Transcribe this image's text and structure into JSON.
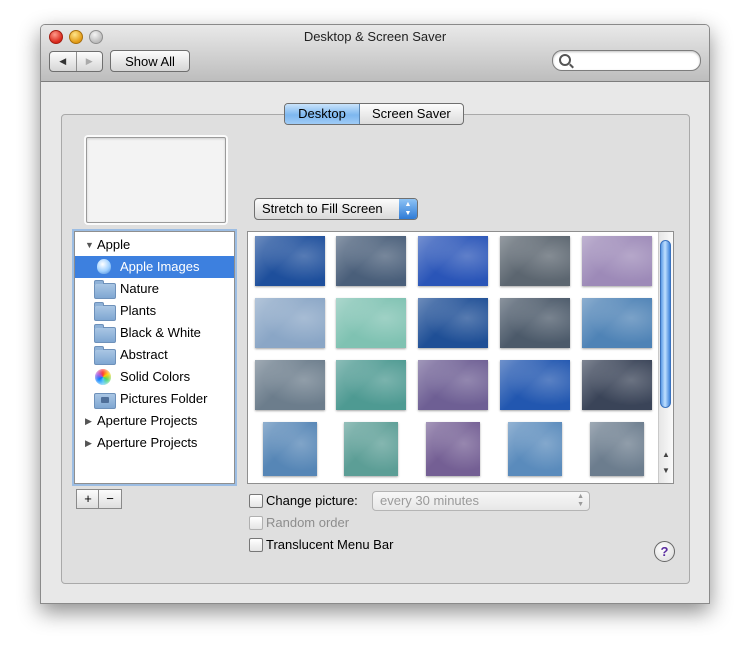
{
  "window": {
    "title": "Desktop & Screen Saver"
  },
  "toolbar": {
    "back_glyph": "◀",
    "forward_glyph": "▶",
    "show_all_label": "Show All",
    "search_placeholder": ""
  },
  "tabs": [
    {
      "label": "Desktop",
      "active": true
    },
    {
      "label": "Screen Saver",
      "active": false
    }
  ],
  "fill_popup": {
    "value": "Stretch to Fill Screen",
    "arrows": "▲▼"
  },
  "sidebar": {
    "items": [
      {
        "label": "Apple",
        "kind": "group",
        "expanded": true,
        "icon": "disclosure-triangle-open"
      },
      {
        "label": "Apple Images",
        "kind": "item",
        "selected": true,
        "icon": "apple-icon"
      },
      {
        "label": "Nature",
        "kind": "item",
        "icon": "folder-icon"
      },
      {
        "label": "Plants",
        "kind": "item",
        "icon": "folder-icon"
      },
      {
        "label": "Black & White",
        "kind": "item",
        "icon": "folder-icon"
      },
      {
        "label": "Abstract",
        "kind": "item",
        "icon": "folder-icon"
      },
      {
        "label": "Solid Colors",
        "kind": "item",
        "icon": "color-wheel-icon"
      },
      {
        "label": "Pictures Folder",
        "kind": "item",
        "icon": "pictures-folder-icon"
      },
      {
        "label": "Aperture Projects",
        "kind": "group",
        "expanded": false,
        "icon": "disclosure-triangle-closed"
      },
      {
        "label": "Aperture Projects",
        "kind": "group",
        "expanded": false,
        "icon": "disclosure-triangle-closed"
      }
    ],
    "triangle_open": "▼",
    "triangle_closed": "▶",
    "add_label": "+",
    "remove_label": "−"
  },
  "wallpapers": {
    "colors": [
      [
        "#1e4f9c",
        "#4a5f7a",
        "#2a55b8",
        "#5c6670",
        "#9d8ab8"
      ],
      [
        "#8aa6c6",
        "#7fc2b2",
        "#1f4f96",
        "#4c5a6a",
        "#4f83b6"
      ],
      [
        "#6c7d8c",
        "#4e9a92",
        "#6e5f94",
        "#2257b0",
        "#3a4458"
      ],
      [
        "#5686b6",
        "#5c9e96",
        "#745f94",
        "#5a8bbc",
        "#6c7d8e"
      ]
    ]
  },
  "options": {
    "change_picture_label": "Change picture:",
    "change_picture_checked": false,
    "interval_value": "every 30 minutes",
    "random_order_label": "Random order",
    "random_order_checked": false,
    "translucent_menu_label": "Translucent Menu Bar",
    "translucent_menu_checked": false
  },
  "scrollbar": {
    "up_glyph": "▲",
    "down_glyph": "▼",
    "position": 0
  },
  "help": {
    "label": "?"
  }
}
